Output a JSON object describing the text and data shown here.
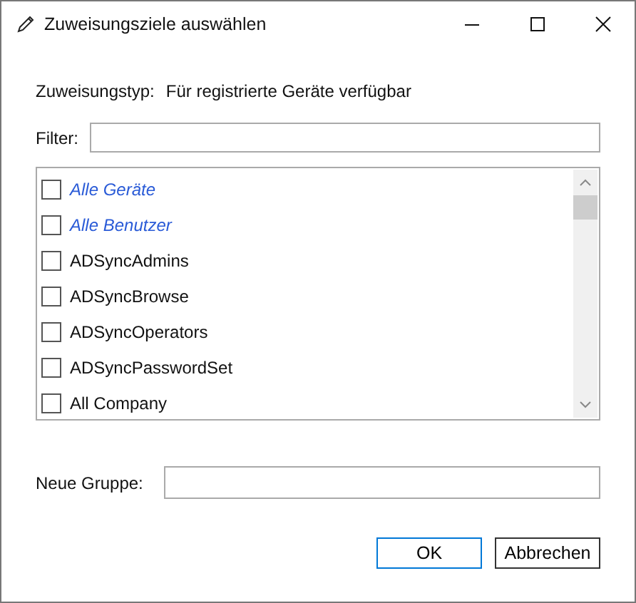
{
  "window": {
    "title": "Zuweisungsziele auswählen"
  },
  "assignment_type": {
    "label": "Zuweisungstyp:",
    "value": "Für registrierte Geräte verfügbar"
  },
  "filter": {
    "label": "Filter:"
  },
  "items": [
    {
      "kind": "special",
      "label": "Alle Geräte",
      "checked": false
    },
    {
      "kind": "special",
      "label": "Alle Benutzer",
      "checked": false
    },
    {
      "kind": "group",
      "label": "ADSyncAdmins",
      "checked": false
    },
    {
      "kind": "group",
      "label": "ADSyncBrowse",
      "checked": false
    },
    {
      "kind": "group",
      "label": "ADSyncOperators",
      "checked": false
    },
    {
      "kind": "group",
      "label": "ADSyncPasswordSet",
      "checked": false
    },
    {
      "kind": "group",
      "label": "All Company",
      "checked": false
    }
  ],
  "new_group": {
    "label": "Neue Gruppe:"
  },
  "buttons": [
    {
      "label": "OK",
      "default": true
    },
    {
      "label": "Abbrechen",
      "default": false
    }
  ]
}
